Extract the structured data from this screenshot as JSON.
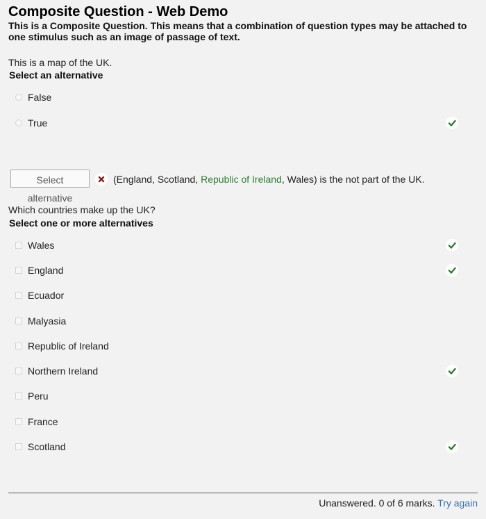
{
  "header": {
    "title": "Composite Question - Web Demo",
    "intro": "This is a Composite Question. This means that a combination of question types may be attached to one stimulus such as an image of passage of text."
  },
  "q1": {
    "prompt": "This is a map of the UK.",
    "instruction": "Select an alternative",
    "options": [
      {
        "label": "False",
        "correct": false
      },
      {
        "label": "True",
        "correct": true
      }
    ]
  },
  "q2": {
    "select_label": "Select alternative",
    "status": "incorrect",
    "sentence_open": "(England, Scotland, ",
    "highlight": "Republic of Ireland",
    "sentence_close": ", Wales) is the not part of the UK."
  },
  "q3": {
    "prompt": "Which countries make up the UK?",
    "instruction": "Select one or more alternatives",
    "options": [
      {
        "label": "Wales",
        "correct": true
      },
      {
        "label": "England",
        "correct": true
      },
      {
        "label": "Ecuador",
        "correct": false
      },
      {
        "label": "Malyasia",
        "correct": false
      },
      {
        "label": "Republic of Ireland",
        "correct": false
      },
      {
        "label": "Northern Ireland",
        "correct": true
      },
      {
        "label": "Peru",
        "correct": false
      },
      {
        "label": "France",
        "correct": false
      },
      {
        "label": "Scotland",
        "correct": true
      }
    ]
  },
  "footer": {
    "status": "Unanswered. 0 of 6 marks.",
    "try_again": "Try again"
  },
  "colors": {
    "background": "#f2f2f2",
    "correct_green": "#2e7d32",
    "incorrect_red": "#8b1a1a",
    "link_blue": "#3a6fb0"
  }
}
